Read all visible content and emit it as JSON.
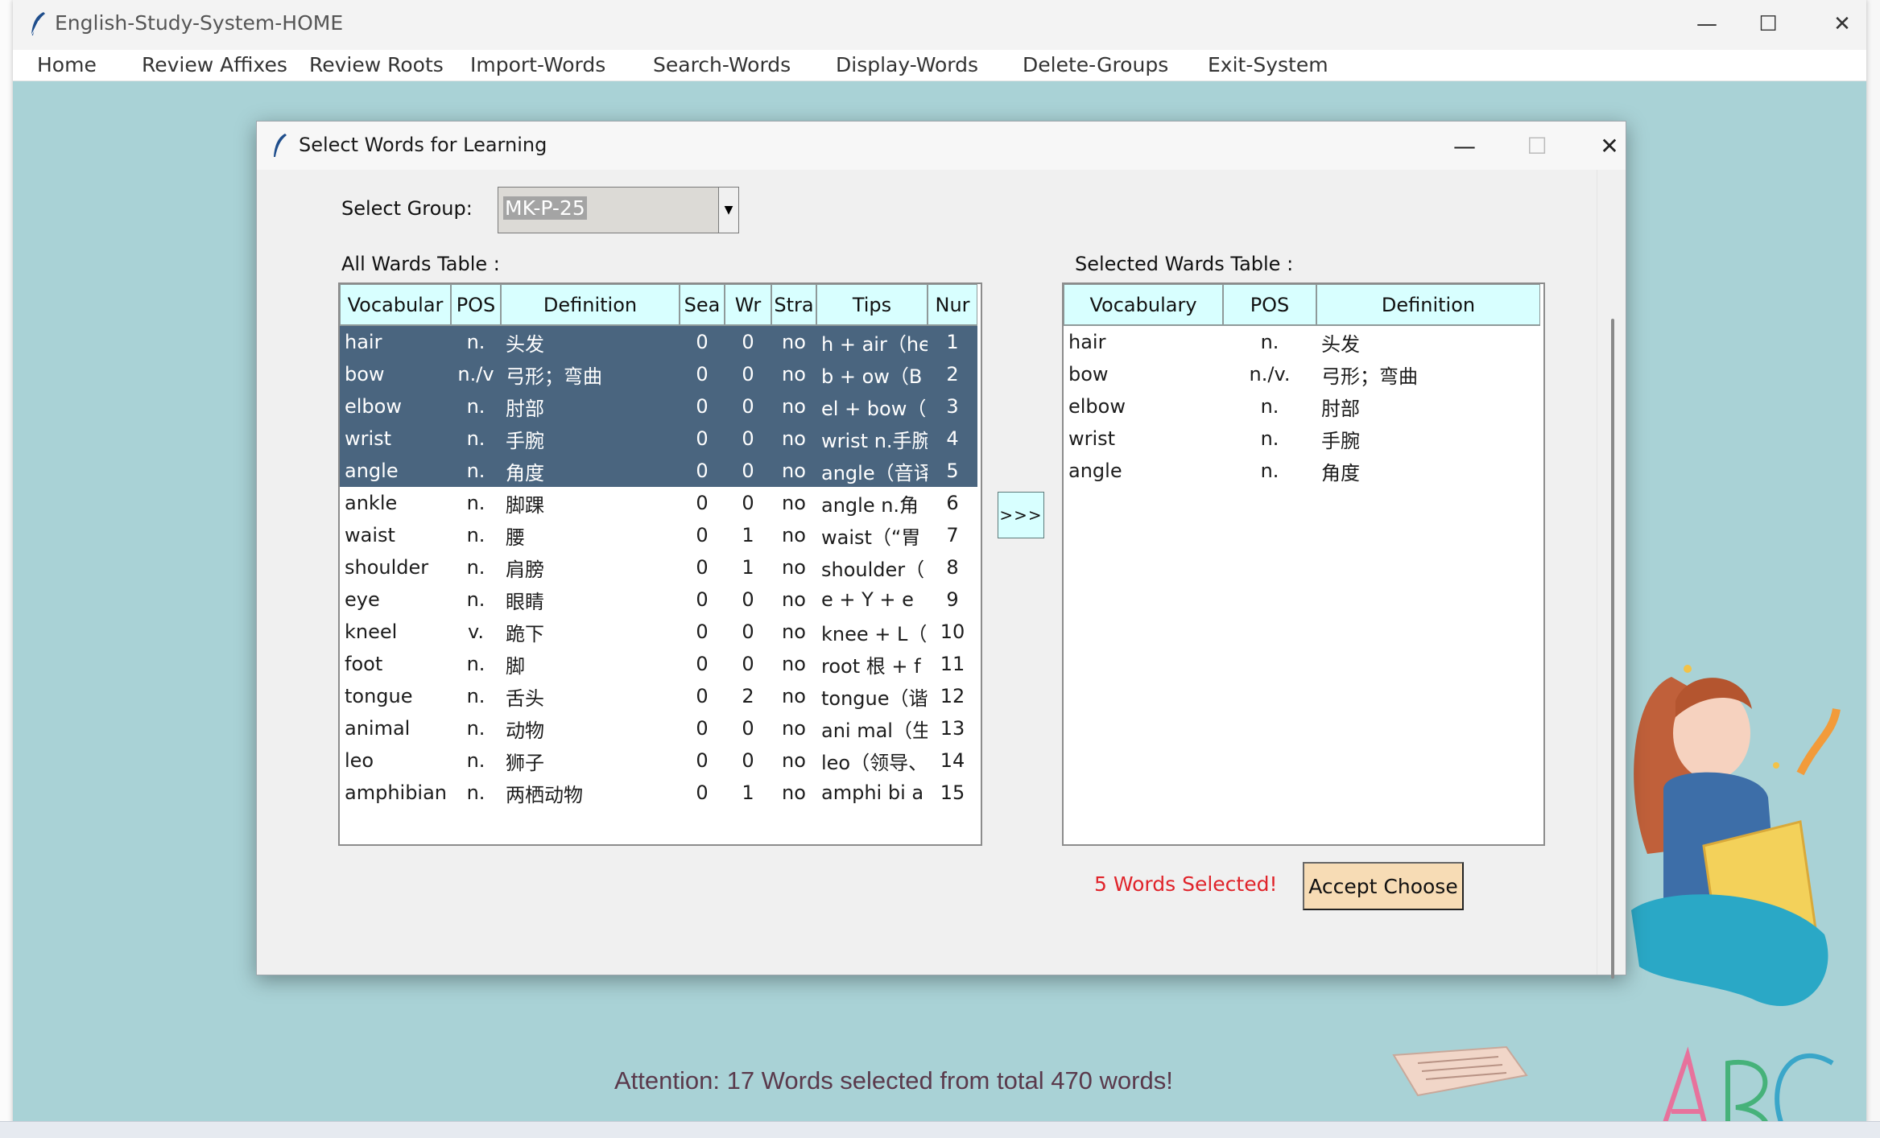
{
  "main_window": {
    "title": "English-Study-System-HOME",
    "controls": {
      "minimize": "—",
      "maximize": "☐",
      "close": "✕"
    }
  },
  "menu": [
    {
      "label": "Home"
    },
    {
      "label": "Review Affixes"
    },
    {
      "label": "Review Roots"
    },
    {
      "label": "Import-Words"
    },
    {
      "label": "Search-Words"
    },
    {
      "label": "Display-Words"
    },
    {
      "label": "Delete-Groups"
    },
    {
      "label": "Exit-System"
    }
  ],
  "attention_text": "Attention: 17 Words selected from total 470 words!",
  "dialog": {
    "title": "Select Words for Learning",
    "controls": {
      "minimize": "—",
      "maximize": "☐",
      "close": "✕"
    },
    "select_group_label": "Select Group:",
    "group_value": "MK-P-25",
    "all_table_label": "All Wards Table :",
    "selected_table_label": "Selected Wards Table :",
    "move_button": ">>>",
    "selected_message": "5 Words Selected!",
    "accept_button": "Accept Choose"
  },
  "all_words": {
    "columns": [
      "Vocabular",
      "POS",
      "Definition",
      "Sea",
      "Wr",
      "Stra",
      "Tips",
      "Nur"
    ],
    "rows": [
      {
        "vocab": "hair",
        "pos": "n.",
        "def": "头发",
        "sea": "0",
        "wr": "0",
        "stra": "no",
        "tips": "h + air（he",
        "num": "1",
        "selected": true
      },
      {
        "vocab": "bow",
        "pos": "n./v",
        "def": "弓形；弯曲",
        "sea": "0",
        "wr": "0",
        "stra": "no",
        "tips": "b + ow（B",
        "num": "2",
        "selected": true
      },
      {
        "vocab": "elbow",
        "pos": "n.",
        "def": "肘部",
        "sea": "0",
        "wr": "0",
        "stra": "no",
        "tips": "el + bow（",
        "num": "3",
        "selected": true
      },
      {
        "vocab": "wrist",
        "pos": "n.",
        "def": "手腕",
        "sea": "0",
        "wr": "0",
        "stra": "no",
        "tips": "wrist n.手腕",
        "num": "4",
        "selected": true
      },
      {
        "vocab": "angle",
        "pos": "n.",
        "def": "角度",
        "sea": "0",
        "wr": "0",
        "stra": "no",
        "tips": "angle（音译",
        "num": "5",
        "selected": true
      },
      {
        "vocab": "ankle",
        "pos": "n.",
        "def": "脚踝",
        "sea": "0",
        "wr": "0",
        "stra": "no",
        "tips": "angle n.角",
        "num": "6",
        "selected": false
      },
      {
        "vocab": "waist",
        "pos": "n.",
        "def": "腰",
        "sea": "0",
        "wr": "1",
        "stra": "no",
        "tips": "waist（“胃",
        "num": "7",
        "selected": false
      },
      {
        "vocab": "shoulder",
        "pos": "n.",
        "def": "肩膀",
        "sea": "0",
        "wr": "1",
        "stra": "no",
        "tips": "shoulder（",
        "num": "8",
        "selected": false
      },
      {
        "vocab": "eye",
        "pos": "n.",
        "def": "眼睛",
        "sea": "0",
        "wr": "0",
        "stra": "no",
        "tips": "e + Y + e",
        "num": "9",
        "selected": false
      },
      {
        "vocab": "kneel",
        "pos": "v.",
        "def": "跪下",
        "sea": "0",
        "wr": "0",
        "stra": "no",
        "tips": "knee + L（",
        "num": "10",
        "selected": false
      },
      {
        "vocab": "foot",
        "pos": "n.",
        "def": "脚",
        "sea": "0",
        "wr": "0",
        "stra": "no",
        "tips": "root 根 + f",
        "num": "11",
        "selected": false
      },
      {
        "vocab": "tongue",
        "pos": "n.",
        "def": "舌头",
        "sea": "0",
        "wr": "2",
        "stra": "no",
        "tips": "tongue（谐",
        "num": "12",
        "selected": false
      },
      {
        "vocab": "animal",
        "pos": "n.",
        "def": "动物",
        "sea": "0",
        "wr": "0",
        "stra": "no",
        "tips": "ani mal（生",
        "num": "13",
        "selected": false
      },
      {
        "vocab": "leo",
        "pos": "n.",
        "def": "狮子",
        "sea": "0",
        "wr": "0",
        "stra": "no",
        "tips": "leo（领导、",
        "num": "14",
        "selected": false
      },
      {
        "vocab": "amphibian",
        "pos": "n.",
        "def": "两栖动物",
        "sea": "0",
        "wr": "1",
        "stra": "no",
        "tips": "amphi bi a",
        "num": "15",
        "selected": false
      }
    ]
  },
  "selected_words": {
    "columns": [
      "Vocabulary",
      "POS",
      "Definition"
    ],
    "rows": [
      {
        "vocab": "hair",
        "pos": "n.",
        "def": "头发"
      },
      {
        "vocab": "bow",
        "pos": "n./v.",
        "def": "弓形；弯曲"
      },
      {
        "vocab": "elbow",
        "pos": "n.",
        "def": "肘部"
      },
      {
        "vocab": "wrist",
        "pos": "n.",
        "def": "手腕"
      },
      {
        "vocab": "angle",
        "pos": "n.",
        "def": "角度"
      }
    ]
  },
  "decoration": {
    "abc_text": "ABC"
  },
  "colors": {
    "background": "#a9d2d6",
    "header": "#d8ffff",
    "selection": "#4a657f",
    "accept_button": "#f7dcb5",
    "message": "#e0232a"
  }
}
